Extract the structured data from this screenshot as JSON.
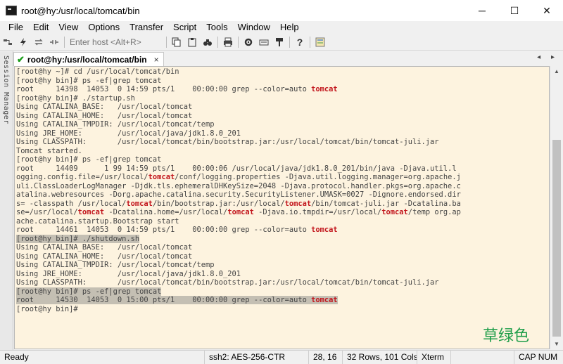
{
  "window": {
    "title": "root@hy:/usr/local/tomcat/bin",
    "minimize": "─",
    "maximize": "☐",
    "close": "✕"
  },
  "menu": [
    "File",
    "Edit",
    "View",
    "Options",
    "Transfer",
    "Script",
    "Tools",
    "Window",
    "Help"
  ],
  "toolbar": {
    "host_placeholder": "Enter host <Alt+R>",
    "icons": [
      "connect-icon",
      "quick-connect-icon",
      "reconnect-icon",
      "disconnect-icon",
      "copy-icon",
      "paste-icon",
      "find-icon",
      "print-icon",
      "settings-icon",
      "keymap-icon",
      "sftp-icon",
      "help-icon",
      "script-icon"
    ]
  },
  "session_manager": {
    "label": "Session Manager"
  },
  "tab": {
    "label": "root@hy:/usr/local/tomcat/bin",
    "close": "×",
    "nav": "◂ ▸"
  },
  "terminal": {
    "keyword_color": "#c2151c",
    "lines": [
      {
        "text": "[root@hy ~]# cd /usr/local/tomcat/bin",
        "hl": false
      },
      {
        "text": "[root@hy bin]# ps -ef|grep tomcat",
        "hl": false
      },
      {
        "text": "root     14398  14053  0 14:59 pts/1    00:00:00 grep --color=auto tomcat",
        "hl": false
      },
      {
        "text": "[root@hy bin]# ./startup.sh",
        "hl": false
      },
      {
        "text": "Using CATALINA_BASE:   /usr/local/tomcat",
        "hl": false
      },
      {
        "text": "Using CATALINA_HOME:   /usr/local/tomcat",
        "hl": false
      },
      {
        "text": "Using CATALINA_TMPDIR: /usr/local/tomcat/temp",
        "hl": false
      },
      {
        "text": "Using JRE_HOME:        /usr/local/java/jdk1.8.0_201",
        "hl": false
      },
      {
        "text": "Using CLASSPATH:       /usr/local/tomcat/bin/bootstrap.jar:/usr/local/tomcat/bin/tomcat-juli.jar",
        "hl": false
      },
      {
        "text": "Tomcat started.",
        "hl": false
      },
      {
        "text": "[root@hy bin]# ps -ef|grep tomcat",
        "hl": false
      },
      {
        "text": "root     14409      1 99 14:59 pts/1    00:00:06 /usr/local/java/jdk1.8.0_201/bin/java -Djava.util.l",
        "hl": false
      },
      {
        "text": "ogging.config.file=/usr/local/tomcat/conf/logging.properties -Djava.util.logging.manager=org.apache.j",
        "hl": false
      },
      {
        "text": "uli.ClassLoaderLogManager -Djdk.tls.ephemeralDHKeySize=2048 -Djava.protocol.handler.pkgs=org.apache.c",
        "hl": false
      },
      {
        "text": "atalina.webresources -Dorg.apache.catalina.security.SecurityListener.UMASK=0027 -Dignore.endorsed.dir",
        "hl": false
      },
      {
        "text": "s= -classpath /usr/local/tomcat/bin/bootstrap.jar:/usr/local/tomcat/bin/tomcat-juli.jar -Dcatalina.ba",
        "hl": false
      },
      {
        "text": "se=/usr/local/tomcat -Dcatalina.home=/usr/local/tomcat -Djava.io.tmpdir=/usr/local/tomcat/temp org.ap",
        "hl": false
      },
      {
        "text": "ache.catalina.startup.Bootstrap start",
        "hl": false
      },
      {
        "text": "root     14461  14053  0 14:59 pts/1    00:00:00 grep --color=auto tomcat",
        "hl": false
      },
      {
        "text": "[root@hy bin]# ./shutdown.sh",
        "hl": true
      },
      {
        "text": "Using CATALINA_BASE:   /usr/local/tomcat",
        "hl": false
      },
      {
        "text": "Using CATALINA_HOME:   /usr/local/tomcat",
        "hl": false
      },
      {
        "text": "Using CATALINA_TMPDIR: /usr/local/tomcat/temp",
        "hl": false
      },
      {
        "text": "Using JRE_HOME:        /usr/local/java/jdk1.8.0_201",
        "hl": false
      },
      {
        "text": "Using CLASSPATH:       /usr/local/tomcat/bin/bootstrap.jar:/usr/local/tomcat/bin/tomcat-juli.jar",
        "hl": false
      },
      {
        "text": "[root@hy bin]# ps -ef|grep tomcat",
        "hl": true
      },
      {
        "text": "root     14530  14053  0 15:00 pts/1    00:00:00 grep --color=auto tomcat",
        "hl": true
      },
      {
        "text": "[root@hy bin]# ",
        "hl": false
      }
    ]
  },
  "watermark": "草绿色",
  "status": {
    "ready": "Ready",
    "encryption": "ssh2: AES-256-CTR",
    "cursor": "28, 16",
    "size": "32 Rows, 101 Cols",
    "term": "Xterm",
    "keys": "CAP NUM"
  }
}
